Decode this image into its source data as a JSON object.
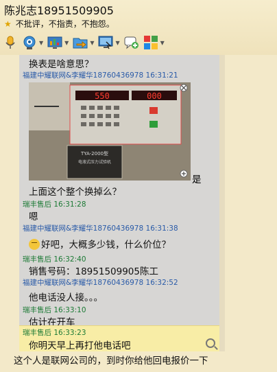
{
  "header": {
    "contact": "陈兆志18951509905",
    "signature": "不批评，不指责，不抱怨。"
  },
  "toolbar": {
    "items": [
      {
        "name": "voice-call",
        "icon": "microphone-icon",
        "dropdown": false
      },
      {
        "name": "video-call",
        "icon": "camera-icon",
        "dropdown": true
      },
      {
        "name": "remote-assist",
        "icon": "screen-share-icon",
        "dropdown": true
      },
      {
        "name": "send-file",
        "icon": "folder-transfer-icon",
        "dropdown": true
      },
      {
        "name": "screen",
        "icon": "monitor-icon",
        "dropdown": true
      },
      {
        "name": "create-discussion",
        "icon": "add-chat-icon",
        "dropdown": false
      },
      {
        "name": "apps",
        "icon": "apps-grid-icon",
        "dropdown": true
      }
    ]
  },
  "chat": {
    "top_message": "换表是啥意思？",
    "photo_sender": "福建中耀联网&李耀华18760436978 16:31:21",
    "photo": {
      "display_left": "550",
      "display_right": "000",
      "plate_text": "TYA-2000型",
      "plate_sub": "电液式压力试验机"
    },
    "after_photo": "是",
    "m1": "上面这个整个换掉么？",
    "m2_meta": "瑞丰售后 16:31:28",
    "m2": "嗯",
    "m3_meta": "福建中耀联网&李耀华18760436978 16:31:38",
    "m3": "好吧，大概多少钱，什么价位？",
    "m4_meta": "瑞丰售后 16:32:40",
    "m4": "销售号码：18951509905陈工",
    "m5_meta": "福建中耀联网&李耀华18760436978 16:32:52",
    "m5": "他电话没人接。。。",
    "m6_meta": "瑞丰售后 16:33:10",
    "m6": "估计在开车",
    "m7_meta": "瑞丰售后 16:33:23",
    "m7": "你明天早上再打他电话吧"
  },
  "input": {
    "text": "这个人是联网公司的，到时你给他回电报价一下"
  },
  "colors": {
    "other_sender": "#2a5ba8",
    "self_sender": "#1c7a35",
    "highlight": "#f8eda6"
  }
}
